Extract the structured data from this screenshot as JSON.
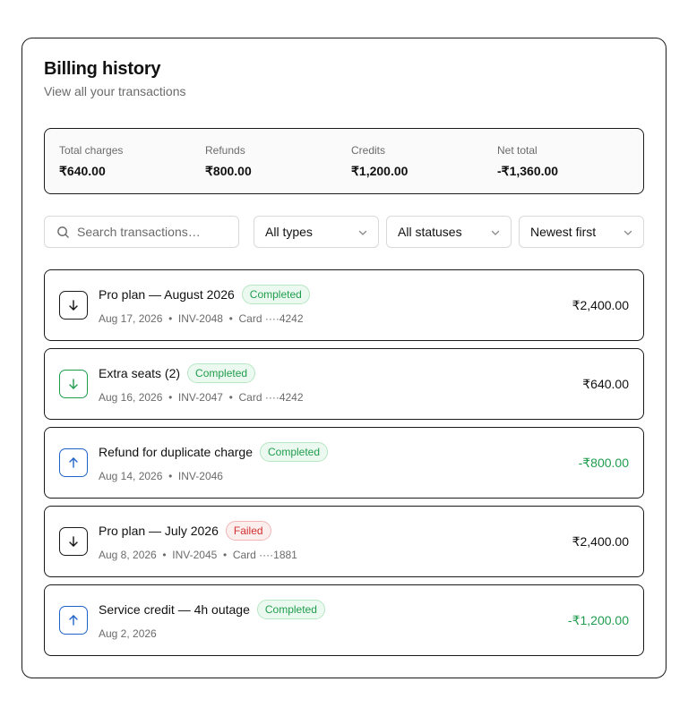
{
  "header": {
    "title": "Billing history",
    "subtitle": "View all your transactions"
  },
  "summary": [
    {
      "label": "Total charges",
      "value": "₹640.00"
    },
    {
      "label": "Refunds",
      "value": "₹800.00"
    },
    {
      "label": "Credits",
      "value": "₹1,200.00"
    },
    {
      "label": "Net total",
      "value": "-₹1,360.00"
    }
  ],
  "filters": {
    "search_placeholder": "Search transactions…",
    "type": "All types",
    "status": "All statuses",
    "sort": "Newest first"
  },
  "transactions": [
    {
      "name": "Pro plan — August 2026",
      "status": "Completed",
      "meta": "Aug 17, 2026  •  INV-2048  •  Card ····4242",
      "amount": "₹2,400.00",
      "direction": "down",
      "icon": "arrow-down-icon"
    },
    {
      "name": "Extra seats (2)",
      "status": "Completed",
      "meta": "Aug 16, 2026  •  INV-2047  •  Card ····4242",
      "amount": "₹640.00",
      "direction": "down",
      "icon": "arrow-down-icon"
    },
    {
      "name": "Refund for duplicate charge",
      "status": "Completed",
      "meta": "Aug 14, 2026  •  INV-2046",
      "amount": "-₹800.00",
      "direction": "up",
      "icon": "arrow-up-icon"
    },
    {
      "name": "Pro plan — July 2026",
      "status": "Failed",
      "meta": "Aug 8, 2026  •  INV-2045  •  Card ····1881",
      "amount": "₹2,400.00",
      "direction": "down",
      "icon": "arrow-down-icon"
    },
    {
      "name": "Service credit — 4h outage",
      "status": "Completed",
      "meta": "Aug 2, 2026",
      "amount": "-₹1,200.00",
      "direction": "up",
      "icon": "arrow-up-icon"
    }
  ],
  "colors": {
    "success": "#1f9d4d",
    "danger": "#d12f2f",
    "info": "#1e63c9",
    "muted": "#6b6b6b",
    "border": "#1a1a1a"
  }
}
